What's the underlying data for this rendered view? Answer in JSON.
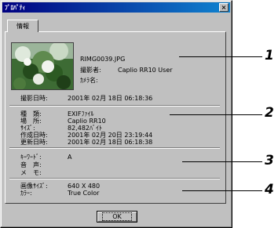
{
  "window": {
    "title": "ﾌﾟﾛﾊﾟﾃｨ",
    "close_glyph": "×"
  },
  "tab": {
    "label": "情報"
  },
  "image_info": {
    "filename": "RIMG0039.JPG",
    "photographer_label": "撮影者:",
    "photographer_value": "Caplio RR10 User",
    "camera_label": "ｶﾒﾗ名:"
  },
  "shoot": {
    "label": "撮影日時:",
    "value": "2001年 02月 18日  06:18:36"
  },
  "file": {
    "rows": [
      {
        "label": "種　類:",
        "value": "EXIFﾌｧｲﾙ"
      },
      {
        "label": "場　所:",
        "value": "Caplio RR10"
      },
      {
        "label": "ｻｲｽﾞ:",
        "value": "82,482ﾊﾞｲﾄ"
      },
      {
        "label": "作成日時:",
        "value": "2001年 02月 20日  23:19:44"
      },
      {
        "label": "更新日時:",
        "value": "2001年 02月 18日  06:18:38"
      }
    ]
  },
  "meta": {
    "rows": [
      {
        "label": "ｷｰﾜｰﾄﾞ:",
        "value": "A"
      },
      {
        "label": "音　声:",
        "value": ""
      },
      {
        "label": "メ　モ:",
        "value": ""
      }
    ]
  },
  "image": {
    "rows": [
      {
        "label": "画像ｻｲｽﾞ:",
        "value": "640 X 480"
      },
      {
        "label": "ｶﾗｰ:",
        "value": "True Color"
      }
    ]
  },
  "buttons": {
    "ok_label": "OK"
  },
  "callouts": [
    "1",
    "2",
    "3",
    "4"
  ]
}
